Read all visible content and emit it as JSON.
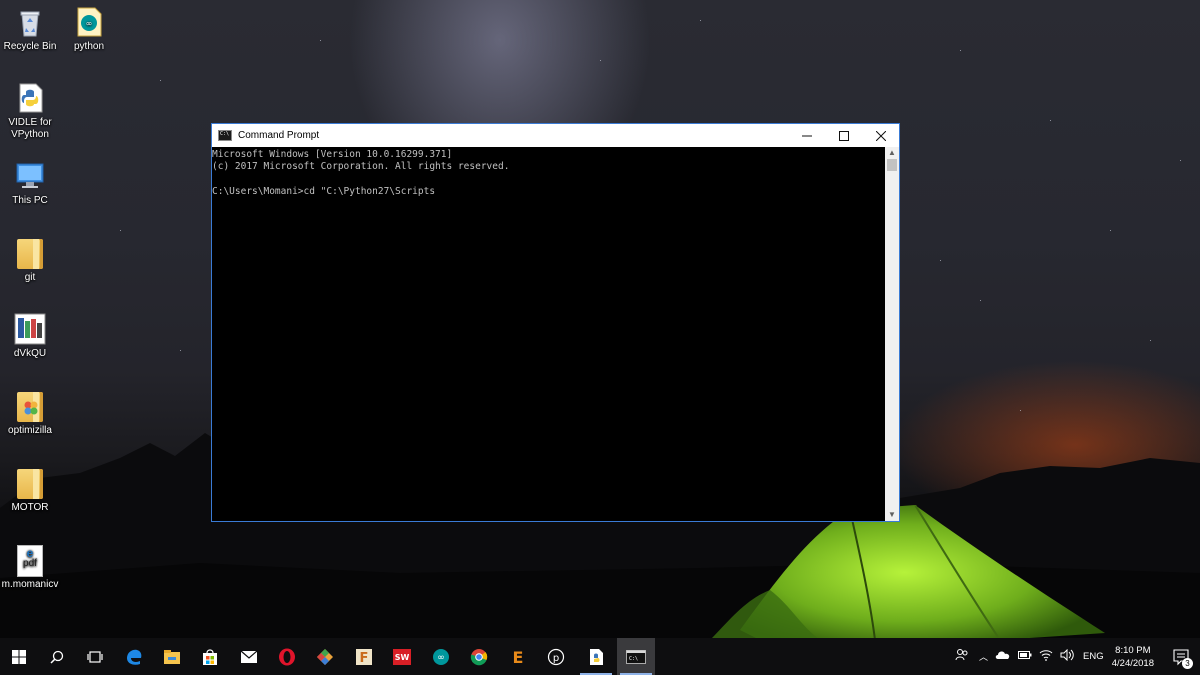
{
  "desktop": {
    "icons": [
      {
        "label": "Recycle Bin",
        "icon": "recycle-bin-icon"
      },
      {
        "label": "python",
        "icon": "arduino-icon"
      },
      {
        "label": "VIDLE for VPython",
        "icon": "python-file-icon"
      },
      {
        "label": "This PC",
        "icon": "computer-icon"
      },
      {
        "label": "git",
        "icon": "folder-icon"
      },
      {
        "label": "dVkQU",
        "icon": "image-file-icon"
      },
      {
        "label": "optimizilla",
        "icon": "folder-icon"
      },
      {
        "label": "MOTOR",
        "icon": "folder-icon"
      },
      {
        "label": "m.momanicv",
        "icon": "pdf-file-icon"
      }
    ],
    "pdf_badge": "pdf"
  },
  "cmd": {
    "title": "Command Prompt",
    "lines": [
      "Microsoft Windows [Version 10.0.16299.371]",
      "(c) 2017 Microsoft Corporation. All rights reserved.",
      "",
      "C:\\Users\\Momani>cd \"C:\\Python27\\Scripts"
    ],
    "colors": {
      "background": "#000000",
      "text": "#c0c0c0",
      "border": "#3a7bd5"
    }
  },
  "taskbar": {
    "apps": [
      {
        "name": "start",
        "icon": "windows-start-icon"
      },
      {
        "name": "search",
        "icon": "search-icon"
      },
      {
        "name": "task-view",
        "icon": "task-view-icon"
      },
      {
        "name": "edge",
        "icon": "edge-icon"
      },
      {
        "name": "file-explorer",
        "icon": "folder-icon"
      },
      {
        "name": "store",
        "icon": "store-icon"
      },
      {
        "name": "mail",
        "icon": "mail-icon"
      },
      {
        "name": "opera",
        "icon": "opera-icon"
      },
      {
        "name": "app-colorful",
        "icon": "diamond-app-icon"
      },
      {
        "name": "fritzing",
        "icon": "fritzing-icon"
      },
      {
        "name": "solidworks",
        "icon": "solidworks-icon"
      },
      {
        "name": "arduino",
        "icon": "arduino-icon"
      },
      {
        "name": "chrome",
        "icon": "chrome-icon"
      },
      {
        "name": "e-app",
        "icon": "e-app-icon"
      },
      {
        "name": "p-app",
        "icon": "p-app-icon"
      },
      {
        "name": "python-idle",
        "icon": "python-idle-icon"
      },
      {
        "name": "command-prompt",
        "icon": "cmd-icon"
      }
    ],
    "tray": {
      "language": "ENG",
      "time": "8:10 PM",
      "date": "4/24/2018",
      "notifications_count": "3"
    }
  }
}
